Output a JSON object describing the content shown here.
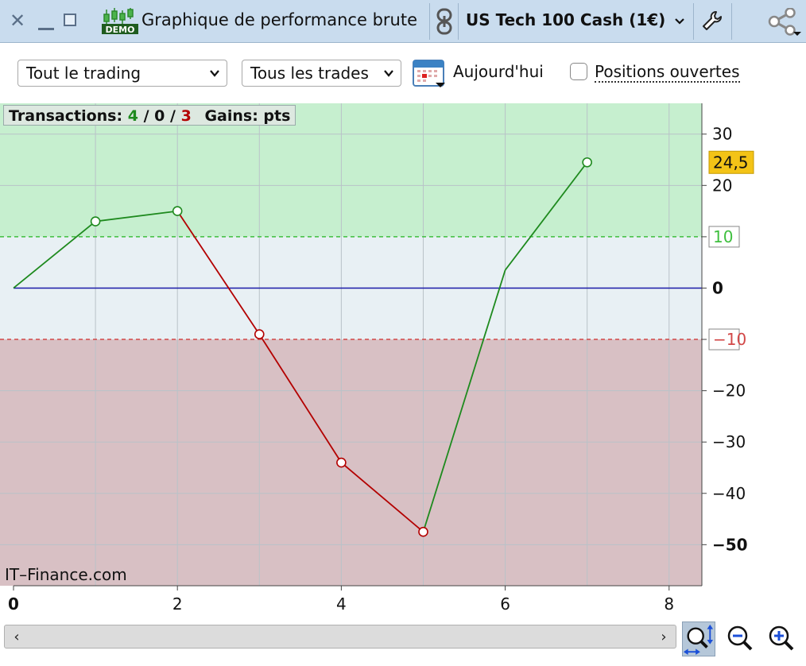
{
  "window": {
    "title": "Graphique de performance brute",
    "demo_badge": "DEMO",
    "instrument": "US Tech 100 Cash (1€)"
  },
  "toolbar": {
    "scope_select": "Tout le trading",
    "trades_select": "Tous les trades",
    "today_label": "Aujourd'hui",
    "open_positions_label": "Positions ouvertes",
    "open_positions_checked": false
  },
  "stats": {
    "transactions_label": "Transactions:",
    "winners": "4",
    "sep1": "/",
    "neutral": "0",
    "sep2": "/",
    "losers": "3",
    "gains_label": "Gains: pts"
  },
  "watermark": "IT–Finance.com",
  "colors": {
    "titlebar": "#c9dcee",
    "gain_zone": "#c6efcf",
    "neutral_zone": "#e8f0f4",
    "loss_zone": "#d8c0c4",
    "gain_line": "#1e8a1e",
    "loss_line": "#b30000",
    "zero_line": "#1a1aa8",
    "last_value_badge": "#f3c317"
  },
  "icons": [
    "close-icon",
    "minimize-icon",
    "maximize-icon",
    "demo-chart-icon",
    "link-icon",
    "chevron-down-icon",
    "wrench-icon",
    "share-icon",
    "calendar-icon",
    "zoom-fit-icon",
    "zoom-out-icon",
    "zoom-in-icon",
    "chevron-left-icon",
    "chevron-right-icon"
  ],
  "chart_data": {
    "type": "line",
    "x": [
      0,
      1,
      2,
      3,
      4,
      5,
      6,
      7
    ],
    "y": [
      0,
      13,
      15,
      -9,
      -34,
      -47.5,
      3.5,
      24.5
    ],
    "xlim": [
      0,
      8.4
    ],
    "ylim": [
      -58,
      36
    ],
    "x_ticks": [
      "0",
      "2",
      "4",
      "6",
      "8"
    ],
    "y_ticks": [
      "30",
      "20",
      "10",
      "0",
      "−10",
      "−20",
      "−30",
      "−40",
      "−50"
    ],
    "y_tick_values": [
      30,
      20,
      10,
      0,
      -10,
      -20,
      -30,
      -40,
      -50
    ],
    "upper_threshold": 10,
    "lower_threshold": -10,
    "last_value_label": "24,5",
    "grid": true
  }
}
